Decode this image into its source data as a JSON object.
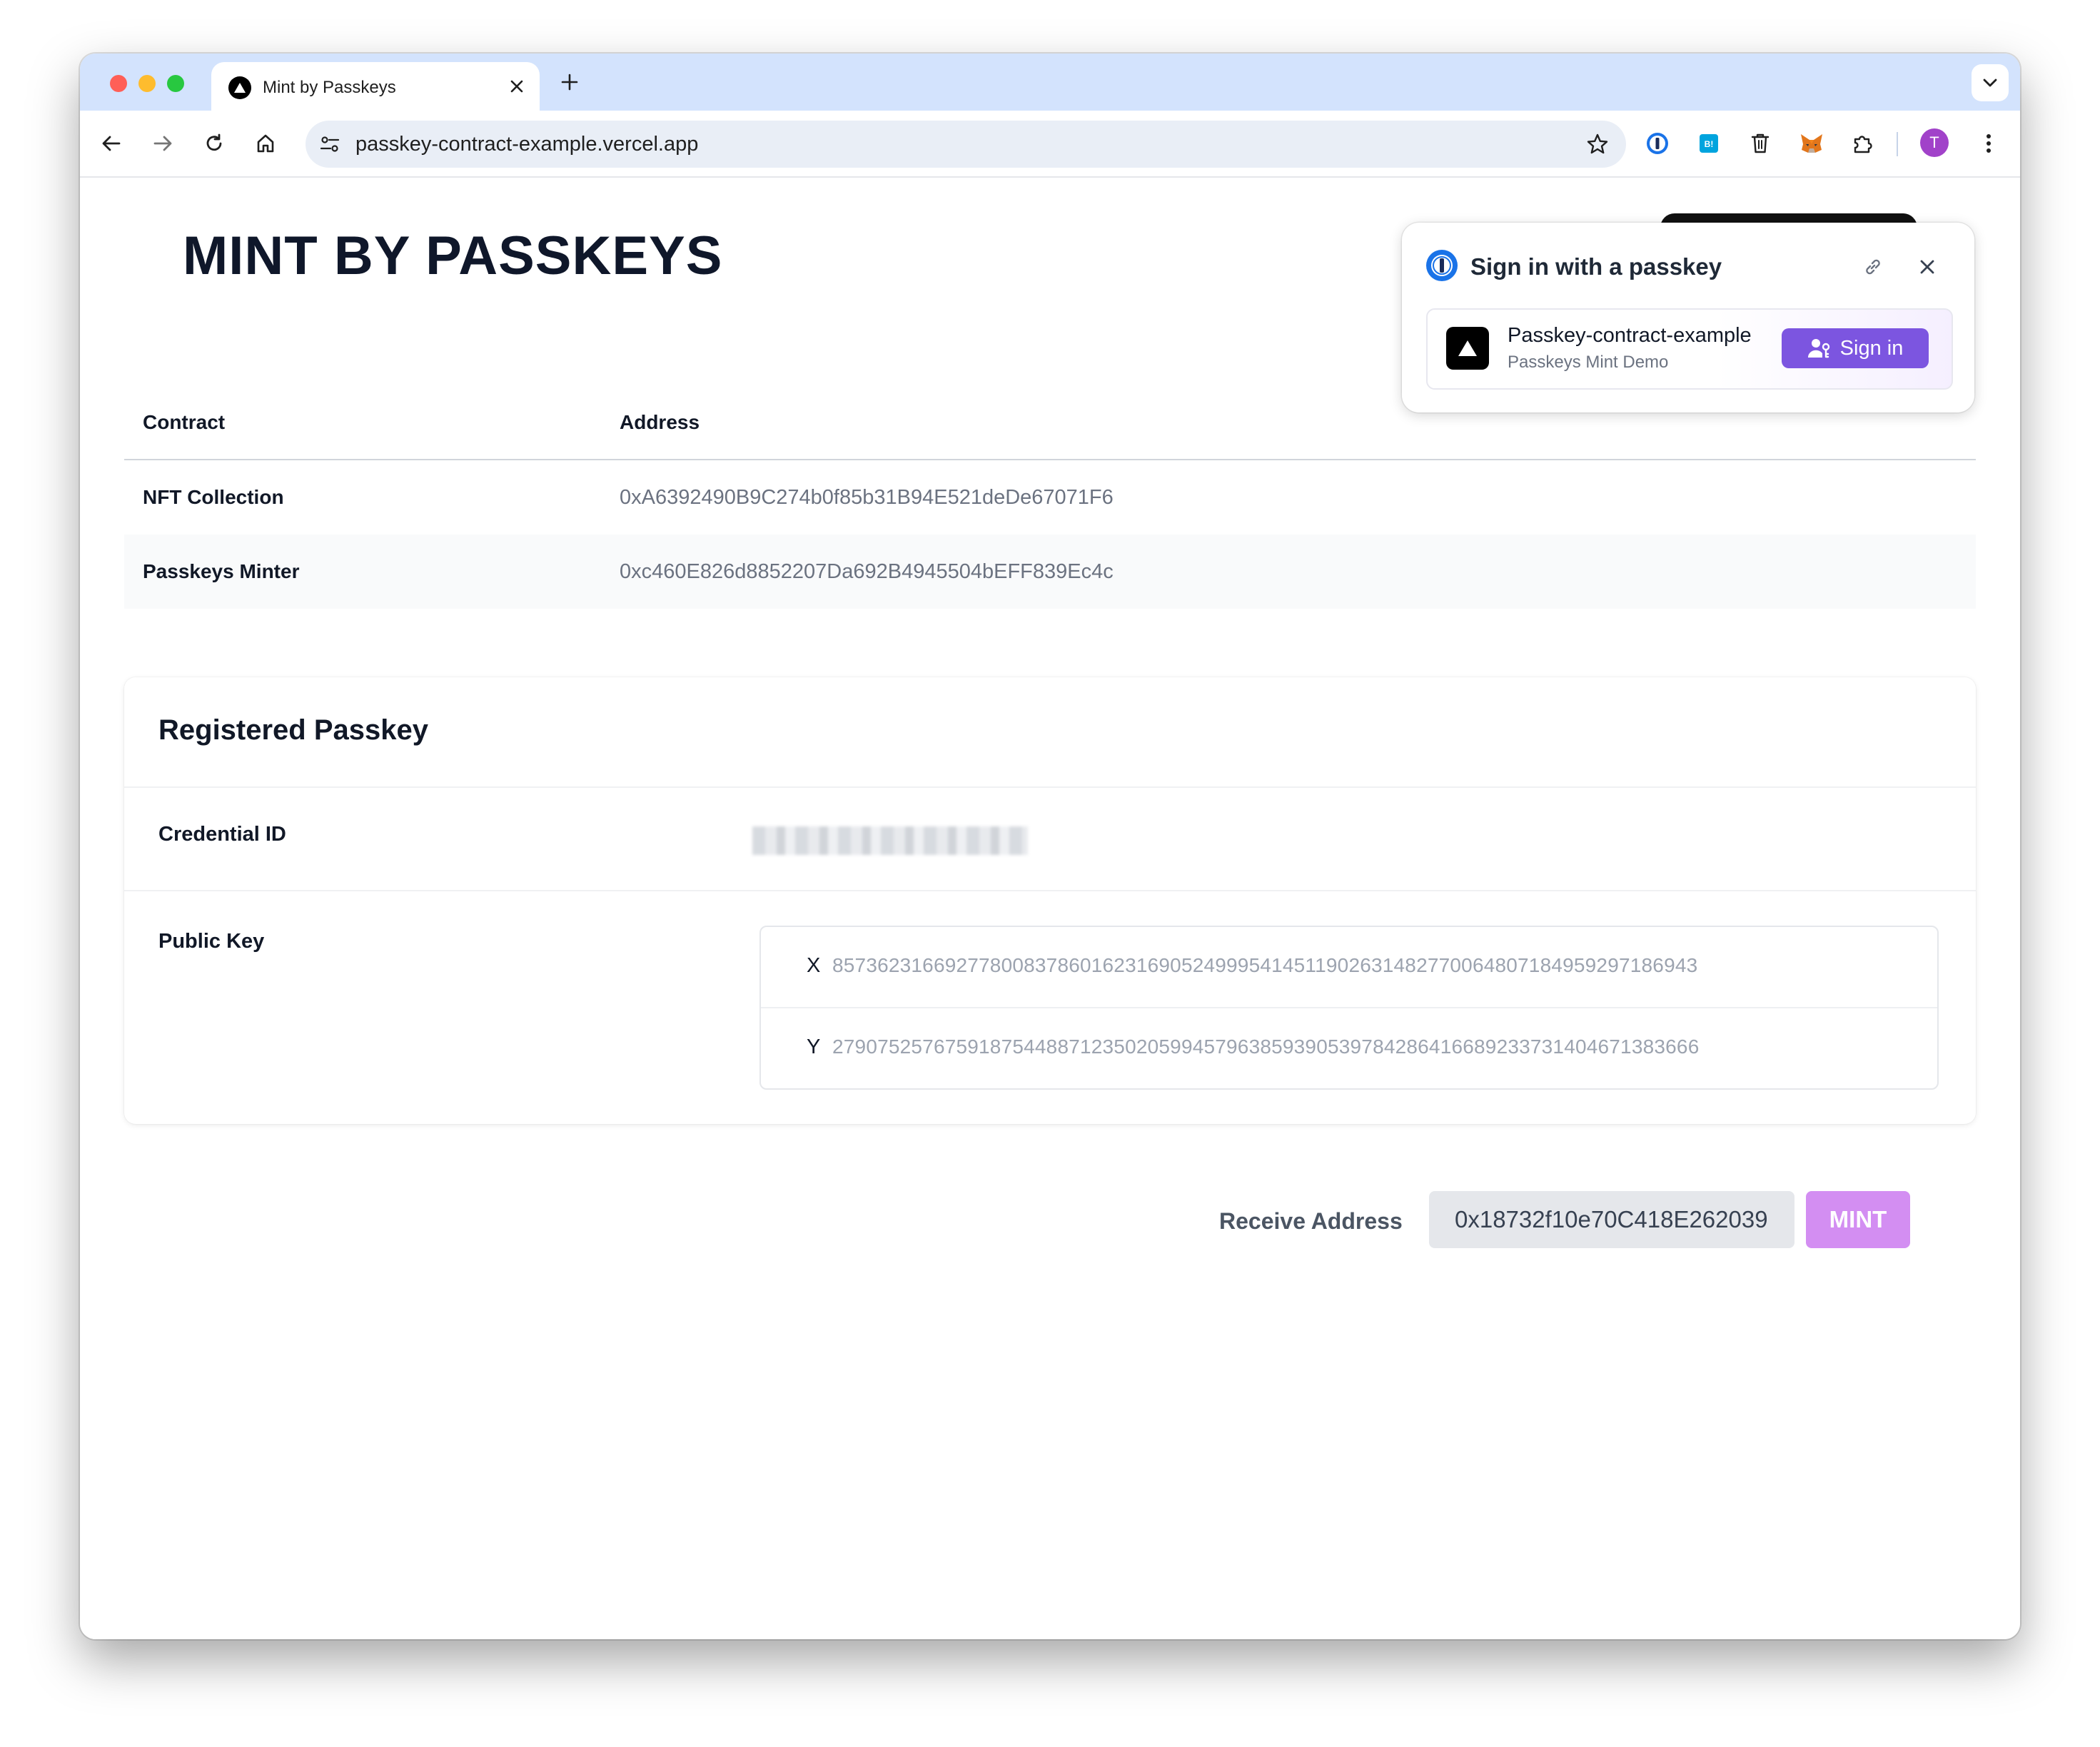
{
  "browser": {
    "tab_title": "Mint by Passkeys",
    "url": "passkey-contract-example.vercel.app",
    "avatar_initial": "T",
    "extension_badge": "B!"
  },
  "page": {
    "title": "MINT BY PASSKEYS",
    "contracts_table": {
      "headers": [
        "Contract",
        "Address"
      ],
      "rows": [
        {
          "name": "NFT Collection",
          "address": "0xA6392490B9C274b0f85b31B94E521deDe67071F6"
        },
        {
          "name": "Passkeys Minter",
          "address": "0xc460E826d8852207Da692B4945504bEFF839Ec4c"
        }
      ]
    },
    "passkey_card": {
      "title": "Registered Passkey",
      "credential_label": "Credential ID",
      "public_key_label": "Public Key",
      "x_label": "X",
      "x_value": "85736231669277800837860162316905249995414511902631482770064807184959297186943",
      "y_label": "Y",
      "y_value": "27907525767591875448871235020599457963859390539784286416689233731404671383666"
    },
    "mint": {
      "receive_label": "Receive Address",
      "receive_value": "0x18732f10e70C418E262039",
      "mint_label": "MINT",
      "mint_color": "#d38ef2"
    }
  },
  "passkey_popup": {
    "title": "Sign in with a passkey",
    "site_name": "Passkey-contract-example",
    "site_sub": "Passkeys Mint Demo",
    "signin_label": "Sign in",
    "accent": "#7c55e0"
  },
  "icons": [
    "back-icon",
    "forward-icon",
    "reload-icon",
    "home-icon",
    "site-settings-icon",
    "bookmark-star-icon",
    "password-manager-icon",
    "hatena-bookmark-icon",
    "trash-icon",
    "metamask-fox-icon",
    "extensions-puzzle-icon",
    "kebab-menu-icon",
    "link-icon",
    "close-icon",
    "user-key-icon",
    "vercel-triangle-icon"
  ]
}
